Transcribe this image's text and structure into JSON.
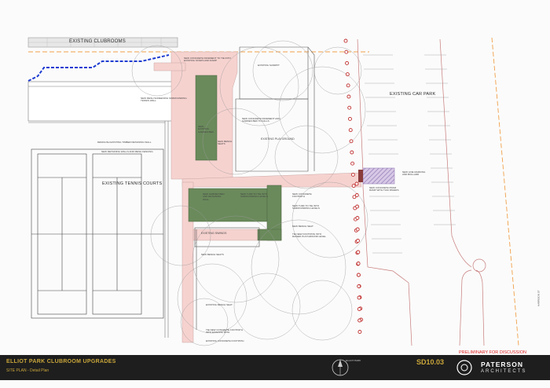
{
  "labels": {
    "clubrooms": "EXISTING CLUBROOMS",
    "sandpit": "EXISTING SANDPIT",
    "car_park": "EXISTING CAR PARK",
    "playground": "EXISTING PLAYGROUND",
    "tennis_courts": "EXISTING TENNIS COURTS",
    "swings": "EXISTING SWINGS"
  },
  "notes": {
    "n_new_pavement": "NEW CONCRETE PAVEMENT TO TIE INTO EXISTING STAIRS AND RAMP",
    "n_mesh_screening": "NEW MESH SCREENING SURROUNDING TENNIS WALL",
    "n_existing_garden": "NEW ... EXISTING GARDEN BED",
    "n_concrete_pavement": "NEW CONCRETE PAVEMENT AND GARDEN BED TO FALLS",
    "n_bench_seats": "NEW BENCH SEATS",
    "n_demolish_wall": "DEMOLISH EXISTING TIMBER RETAINING WALL",
    "n_retaining_walls": "NEW RETAINING WALLS AND MESH FENCING",
    "n_garden_bed_retaining": "NEW GARDEN BED AND RETAINING WALL",
    "n_turf_surrounding": "NEW TURF TO TIE INTO SURROUNDING LEVELS",
    "n_footpath": "NEW CONCRETE FOOTPATH",
    "n_turf_levels": "NEW TURF TO TIE INTO SURROUNDING LEVELS",
    "n_bench_seat": "NEW BENCH SEAT",
    "n_tie_footpath": "TIE NEW FOOTPATH INTO RAISED PLAYGROUND LEVEL",
    "n_line_marking": "NEW LINE MARKING AND BOLLARD",
    "n_pram_ramp": "NEW CONCRETE PRAM RAMP WITH TGSI PAVERS",
    "n_bench_seats2": "NEW BENCH SEATS",
    "n_existing_bench": "EXISTING BENCH SEAT",
    "n_tie_existing_path": "TIE NEW CONCRETE FOOTPATH INTO EXISTING PATH",
    "n_existing_footpath": "EXISTING CONCRETE FOOTPATH",
    "n_harrison": "HARRISON ST"
  },
  "title_block": {
    "project": "ELLIOT PARK CLUBROOM UPGRADES",
    "sheet": "SITE PLAN - Detail Plan",
    "site": "ELLIOT PARK",
    "drawing_no": "SD10.03",
    "preliminary": "PRELIMINARY FOR DISCUSSION",
    "firm": "PATERSON",
    "firm_sub": "ARCHITECTS"
  },
  "colors": {
    "paving_pink": "#f6d2cf",
    "garden_green": "#6a8a5b",
    "hatch_purple": "#b9a6cc",
    "services_blue": "#1d3bd1",
    "boundary_orange": "#f0a04a",
    "title_gold": "#c9a63a",
    "bollard_red": "#c03030"
  },
  "bollards_left_count": 26,
  "bollards_right_count": 14
}
